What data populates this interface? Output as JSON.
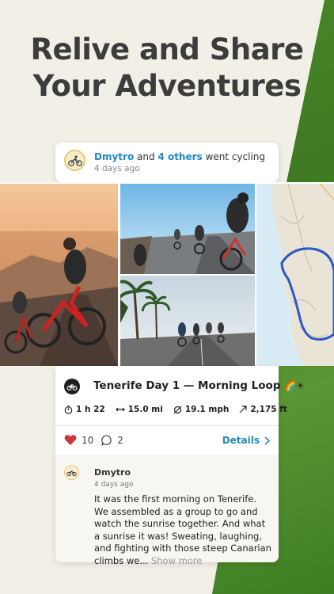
{
  "headline": {
    "line1": "Relive and Share",
    "line2": "Your Adventures"
  },
  "activity": {
    "user": "Dmytro",
    "and": "and",
    "others": "4 others",
    "action": "went cycling",
    "time": "4 days ago"
  },
  "ride": {
    "title": "Tenerife Day 1 — Morning Loop",
    "title_emoji": "🌈☀",
    "duration": "1 h 22",
    "distance": "15.0 mi",
    "speed": "19.1 mph",
    "elevation": "2,175 ft"
  },
  "social": {
    "likes": "10",
    "comments": "2",
    "details_label": "Details"
  },
  "comment": {
    "author": "Dmytro",
    "time": "4 days ago",
    "text": "It was the first morning on Tenerife. We assembled as a group to go and watch the sunrise together. And what a sunrise it was! Sweating, laughing, and fighting with those steep Canarian climbs we...",
    "more": "Show more"
  },
  "colors": {
    "accent_blue": "#1e88c8",
    "heart_red": "#d0343e",
    "green": "#4f8a2c"
  }
}
